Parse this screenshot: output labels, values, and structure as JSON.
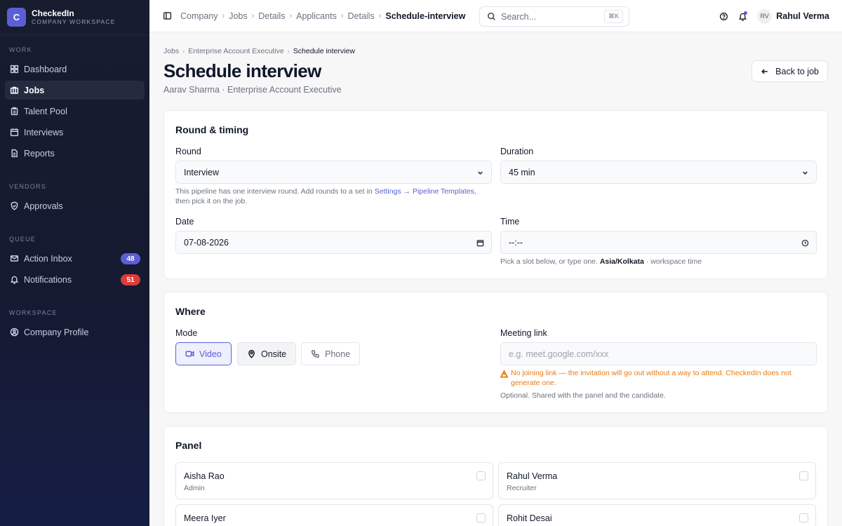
{
  "brand": {
    "logo_letter": "C",
    "name": "CheckedIn",
    "subtitle": "COMPANY WORKSPACE"
  },
  "sidebar": {
    "sections": [
      {
        "label": "WORK",
        "items": [
          {
            "label": "Dashboard",
            "icon": "grid-icon"
          },
          {
            "label": "Jobs",
            "icon": "briefcase-icon",
            "active": true
          },
          {
            "label": "Talent Pool",
            "icon": "clipboard-icon"
          },
          {
            "label": "Interviews",
            "icon": "calendar-icon"
          },
          {
            "label": "Reports",
            "icon": "file-icon"
          }
        ]
      },
      {
        "label": "VENDORS",
        "items": [
          {
            "label": "Approvals",
            "icon": "shield-icon"
          }
        ]
      },
      {
        "label": "QUEUE",
        "items": [
          {
            "label": "Action Inbox",
            "icon": "inbox-icon",
            "badge": "48",
            "badge_color": "#5b5fd6"
          },
          {
            "label": "Notifications",
            "icon": "bell-icon",
            "badge": "51",
            "badge_color": "#dc3b3b"
          }
        ]
      },
      {
        "label": "WORKSPACE",
        "items": [
          {
            "label": "Company Profile",
            "icon": "user-circle-icon"
          }
        ]
      }
    ]
  },
  "topbar": {
    "breadcrumbs": [
      "Company",
      "Jobs",
      "Details",
      "Applicants",
      "Details",
      "Schedule-interview"
    ],
    "search_placeholder": "Search...",
    "search_shortcut": "⌘K",
    "user_initials": "RV",
    "user_name": "Rahul Verma"
  },
  "page": {
    "sub_breadcrumbs": [
      "Jobs",
      "Enterprise Account Executive",
      "Schedule interview"
    ],
    "title": "Schedule interview",
    "subtitle": "Aarav Sharma · Enterprise Account Executive",
    "back_label": "Back to job"
  },
  "round_timing": {
    "title": "Round & timing",
    "round_label": "Round",
    "round_value": "Interview",
    "round_help_prefix": "This pipeline has one interview round. Add rounds to a set in ",
    "round_help_link": "Settings → Pipeline Templates",
    "round_help_suffix": ",",
    "round_help_line2": "then pick it on the job.",
    "duration_label": "Duration",
    "duration_value": "45 min",
    "date_label": "Date",
    "date_value": "07-08-2026",
    "time_label": "Time",
    "time_value": "--:--",
    "time_help_prefix": "Pick a slot below, or type one. ",
    "time_help_tz": "Asia/Kolkata",
    "time_help_suffix": " · workspace time"
  },
  "where": {
    "title": "Where",
    "mode_label": "Mode",
    "modes": [
      {
        "label": "Video",
        "icon": "video-icon",
        "state": "selected"
      },
      {
        "label": "Onsite",
        "icon": "map-pin-icon",
        "state": "neutral"
      },
      {
        "label": "Phone",
        "icon": "phone-icon",
        "state": "plain"
      }
    ],
    "link_label": "Meeting link",
    "link_placeholder": "e.g. meet.google.com/xxx",
    "warning": "No joining link — the invitation will go out without a way to attend. CheckedIn does not generate one.",
    "link_help": "Optional. Shared with the panel and the candidate."
  },
  "panel": {
    "title": "Panel",
    "members": [
      {
        "name": "Aisha Rao",
        "role": "Admin"
      },
      {
        "name": "Rahul Verma",
        "role": "Recruiter"
      },
      {
        "name": "Meera Iyer",
        "role": ""
      },
      {
        "name": "Rohit Desai",
        "role": ""
      }
    ]
  },
  "colors": {
    "accent": "#5b5fd6",
    "danger": "#dc3b3b",
    "warning": "#ea7b16",
    "sidebar_bg": "#171c2e"
  }
}
